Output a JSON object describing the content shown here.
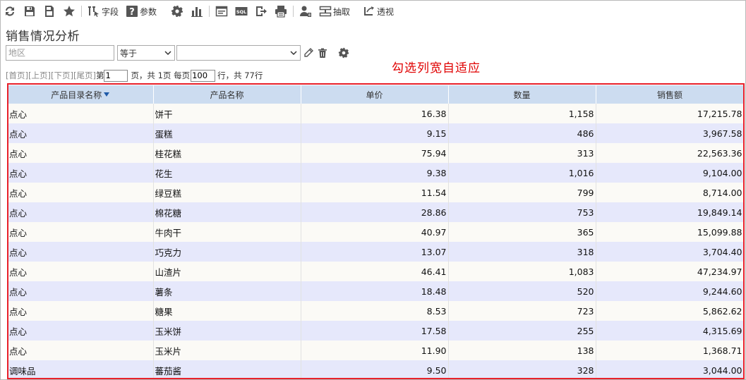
{
  "toolbar": {
    "items": [
      {
        "name": "refresh-icon"
      },
      {
        "name": "save-icon"
      },
      {
        "name": "save-as-icon"
      },
      {
        "name": "favorite-icon"
      },
      {
        "name": "field-icon",
        "label": "字段"
      },
      {
        "name": "params-icon",
        "label": "参数"
      },
      {
        "name": "settings-icon"
      },
      {
        "name": "chart-icon"
      },
      {
        "name": "layout-icon"
      },
      {
        "name": "sql-icon"
      },
      {
        "name": "export-icon"
      },
      {
        "name": "print-icon"
      },
      {
        "name": "user-icon"
      },
      {
        "name": "extract-icon",
        "label": "抽取"
      },
      {
        "name": "pivot-icon",
        "label": "透视"
      }
    ],
    "field_label": "字段",
    "params_label": "参数",
    "extract_label": "抽取",
    "pivot_label": "透视",
    "sql_text": "SQL"
  },
  "page_title": "销售情况分析",
  "filter": {
    "field_placeholder": "地区",
    "operator_value": "等于",
    "value_select": ""
  },
  "annotation": "勾选列宽自适应",
  "pager": {
    "first": "[首页]",
    "prev": "[上页]",
    "next": "[下页]",
    "last": "[尾页]",
    "page_prefix": " 第",
    "current_page": "1",
    "page_suffix": " 页，共 1页 每页",
    "page_size": "100",
    "rows_suffix": " 行，共 77行"
  },
  "table": {
    "columns": [
      "产品目录名称",
      "产品名称",
      "单价",
      "数量",
      "销售额"
    ],
    "rows": [
      [
        "点心",
        "饼干",
        "16.38",
        "1,158",
        "17,215.78"
      ],
      [
        "点心",
        "蛋糕",
        "9.15",
        "486",
        "3,967.58"
      ],
      [
        "点心",
        "桂花糕",
        "75.94",
        "313",
        "22,563.36"
      ],
      [
        "点心",
        "花生",
        "9.38",
        "1,016",
        "9,104.00"
      ],
      [
        "点心",
        "绿豆糕",
        "11.54",
        "799",
        "8,714.00"
      ],
      [
        "点心",
        "棉花糖",
        "28.86",
        "753",
        "19,849.14"
      ],
      [
        "点心",
        "牛肉干",
        "40.97",
        "365",
        "15,099.88"
      ],
      [
        "点心",
        "巧克力",
        "13.07",
        "318",
        "3,704.40"
      ],
      [
        "点心",
        "山渣片",
        "46.41",
        "1,083",
        "47,234.97"
      ],
      [
        "点心",
        "薯条",
        "18.48",
        "520",
        "9,244.60"
      ],
      [
        "点心",
        "糖果",
        "8.53",
        "723",
        "5,862.62"
      ],
      [
        "点心",
        "玉米饼",
        "17.58",
        "255",
        "4,315.69"
      ],
      [
        "点心",
        "玉米片",
        "11.90",
        "138",
        "1,368.71"
      ],
      [
        "调味品",
        "蕃茄酱",
        "9.50",
        "328",
        "3,044.00"
      ]
    ]
  },
  "colors": {
    "accent_blue": "#1e5aa8",
    "header_bg": "#ccdcf0",
    "row_odd": "#fbfaf6",
    "row_even": "#e6e8fb",
    "highlight_red": "#e8202a"
  }
}
